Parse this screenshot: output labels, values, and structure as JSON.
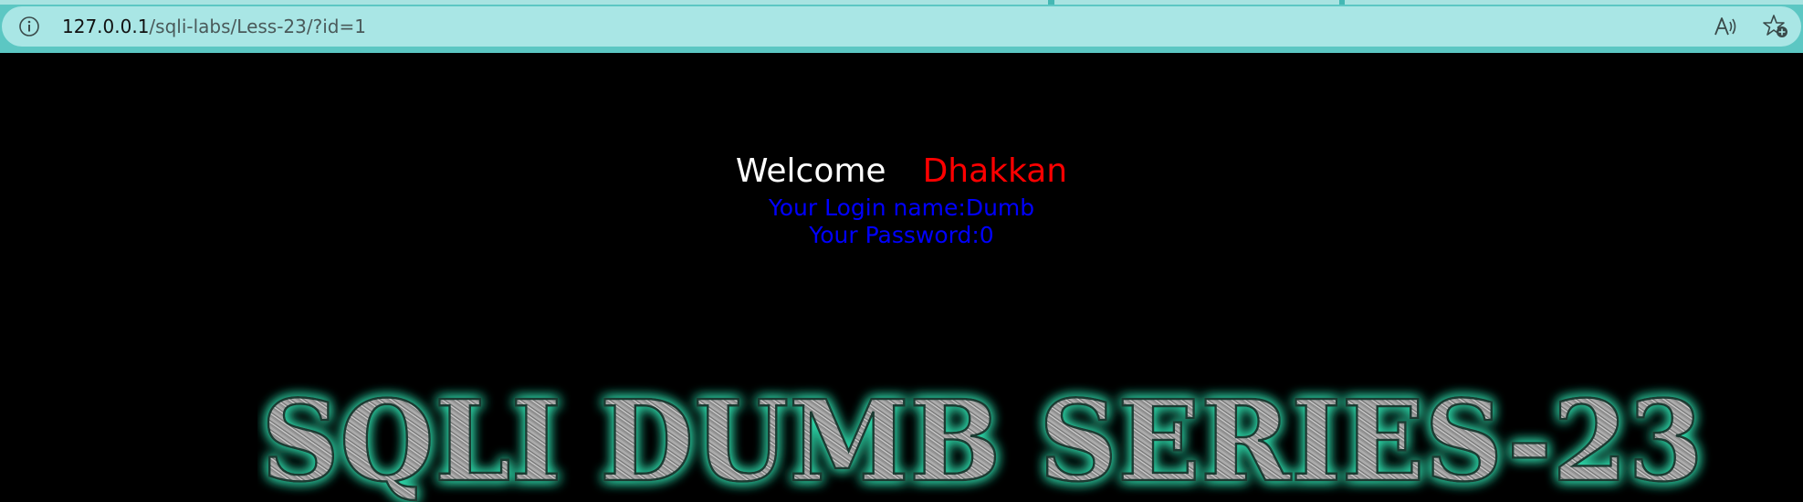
{
  "browser": {
    "url_host": "127.0.0.1",
    "url_path": "/sqli-labs/Less-23/?id=1",
    "info_icon": "info-icon",
    "read_aloud_icon": "read-aloud-icon",
    "favorites_icon": "add-favorite-icon",
    "colors": {
      "toolbar": "#5cc7c3",
      "address_field": "#a9e6e5"
    }
  },
  "page": {
    "welcome_label": "Welcome",
    "user_name": "Dhakkan",
    "login_line": "Your Login name:Dumb",
    "password_line": "Your Password:0",
    "banner_text": "SQLI DUMB SERIES-23",
    "colors": {
      "background": "#000000",
      "welcome": "#ffffff",
      "name": "#ff0000",
      "credentials": "#0000ff",
      "banner_glow": "#2fd6a8"
    }
  }
}
